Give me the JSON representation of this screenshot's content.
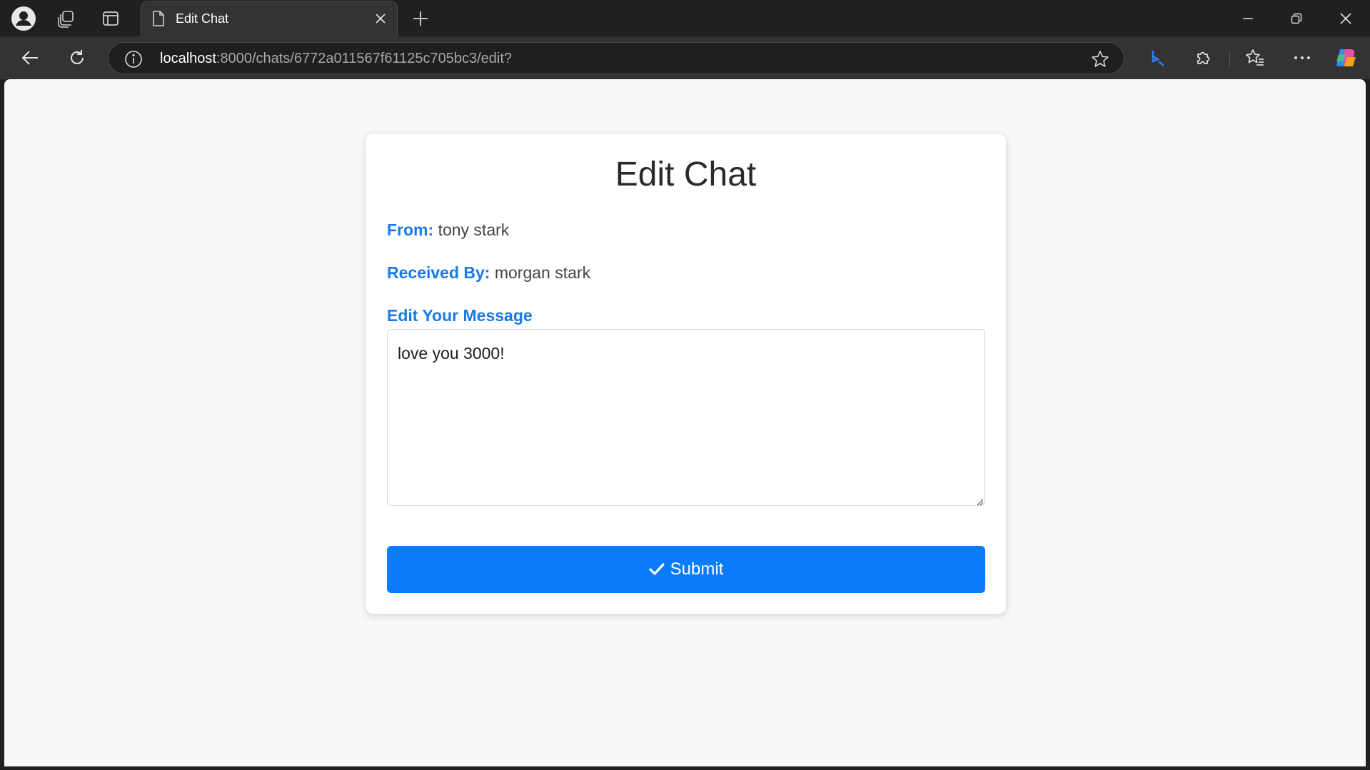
{
  "browser": {
    "tab_title": "Edit Chat",
    "url_host": "localhost",
    "url_rest": ":8000/chats/6772a011567f61125c705bc3/edit?"
  },
  "icons": {
    "profile": "profile-icon",
    "workspaces": "workspaces-icon",
    "tab_actions": "tab-actions-icon",
    "page": "page-icon",
    "close": "close-icon",
    "new_tab": "plus-icon",
    "minimize": "minimize-icon",
    "restore": "restore-icon",
    "window_close": "window-close-icon",
    "back": "back-arrow-icon",
    "refresh": "refresh-icon",
    "info": "info-icon",
    "favorite": "star-icon",
    "bing": "bing-icon",
    "extensions": "puzzle-icon",
    "favorites": "favorites-icon",
    "more": "more-icon",
    "copilot": "copilot-icon",
    "check": "check-icon"
  },
  "colors": {
    "accent": "#0a7cfb",
    "label_blue": "#1a7ae8"
  },
  "page": {
    "heading": "Edit Chat",
    "from_label": "From:",
    "from_value": "tony stark",
    "to_label": "Received By:",
    "to_value": "morgan stark",
    "message_label": "Edit Your Message",
    "message_value": "love you 3000!",
    "submit_label": "Submit"
  }
}
